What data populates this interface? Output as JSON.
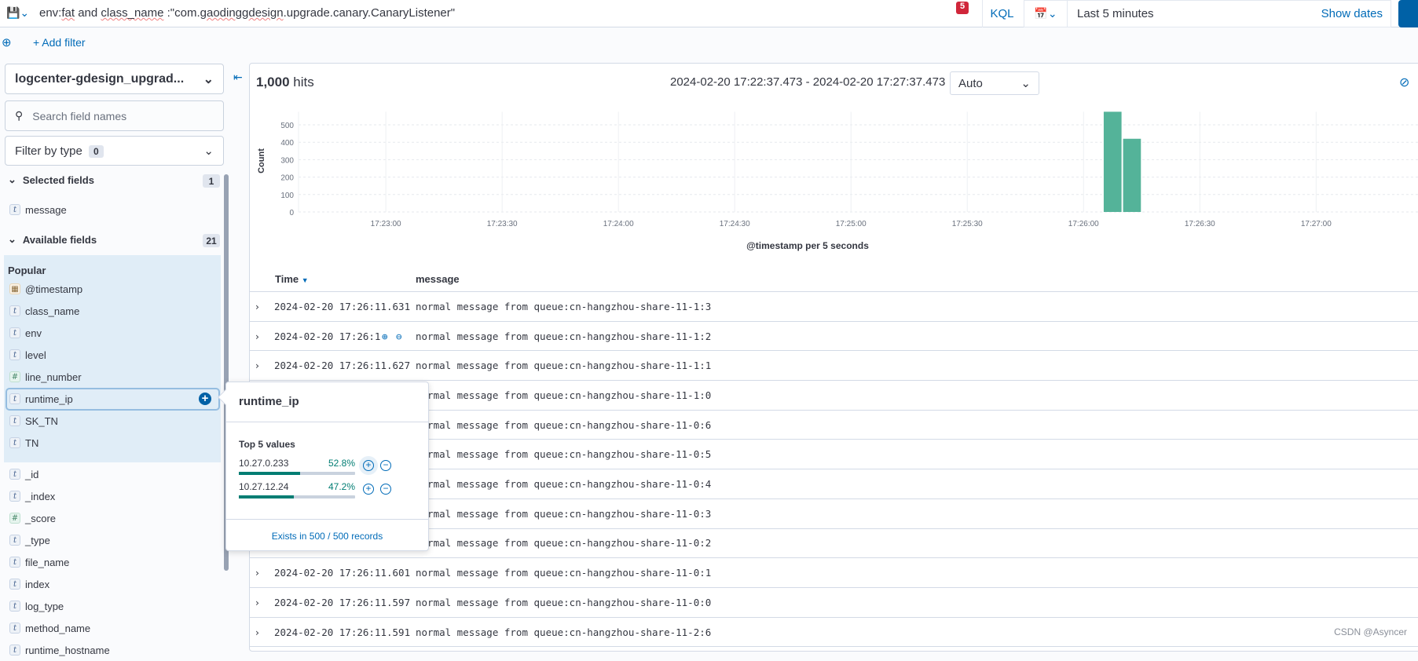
{
  "query": {
    "prefix": "env:",
    "fat": "fat",
    "and": " and ",
    "class_name": "class_name",
    "rest1": " :\"com.",
    "gaoding": "gaoding",
    ".": ".",
    "gdesign": "gdesign",
    "rest2": ".upgrade.canary.CanaryListener\"",
    "badge": "5",
    "language": "KQL"
  },
  "time": {
    "range": "Last 5 minutes",
    "show_dates": "Show dates"
  },
  "filters": {
    "add_filter": "+ Add filter"
  },
  "sidebar": {
    "index_pattern": "logcenter-gdesign_upgrad...",
    "search_placeholder": "Search field names",
    "filter_by_type": "Filter by type",
    "filter_count": "0",
    "selected_label": "Selected fields",
    "selected_count": "1",
    "selected": [
      {
        "name": "message",
        "type": "t"
      }
    ],
    "available_label": "Available fields",
    "available_count": "21",
    "popular_label": "Popular",
    "popular": [
      {
        "name": "@timestamp",
        "type": "date"
      },
      {
        "name": "class_name",
        "type": "t"
      },
      {
        "name": "env",
        "type": "t"
      },
      {
        "name": "level",
        "type": "t"
      },
      {
        "name": "line_number",
        "type": "#"
      },
      {
        "name": "runtime_ip",
        "type": "t"
      },
      {
        "name": "SK_TN",
        "type": "t"
      },
      {
        "name": "TN",
        "type": "t"
      }
    ],
    "others": [
      {
        "name": "_id",
        "type": "t"
      },
      {
        "name": "_index",
        "type": "t"
      },
      {
        "name": "_score",
        "type": "#"
      },
      {
        "name": "_type",
        "type": "t"
      },
      {
        "name": "file_name",
        "type": "t"
      },
      {
        "name": "index",
        "type": "t"
      },
      {
        "name": "log_type",
        "type": "t"
      },
      {
        "name": "method_name",
        "type": "t"
      },
      {
        "name": "runtime_hostname",
        "type": "t"
      }
    ]
  },
  "hits": {
    "count": "1,000",
    "label": " hits",
    "range": "2024-02-20 17:22:37.473 - 2024-02-20 17:27:37.473",
    "interval": "Auto"
  },
  "chart_data": {
    "type": "bar",
    "xlabel": "@timestamp per 5 seconds",
    "ylabel": "Count",
    "x_ticks": [
      "17:23:00",
      "17:23:30",
      "17:24:00",
      "17:24:30",
      "17:25:00",
      "17:25:30",
      "17:26:00",
      "17:26:30",
      "17:27:00"
    ],
    "y_ticks": [
      0,
      100,
      200,
      300,
      400,
      500
    ],
    "xlim": [
      "17:22:37.473",
      "17:27:37.473"
    ],
    "ylim": [
      0,
      575
    ],
    "grid": true,
    "color": "#54b399",
    "bars": [
      {
        "x": "17:26:05",
        "value": 580
      },
      {
        "x": "17:26:10",
        "value": 420
      }
    ]
  },
  "table": {
    "columns": [
      "Time",
      "message"
    ],
    "rows": [
      {
        "time": "2024-02-20 17:26:11.631",
        "message": "normal message from queue:cn-hangzhou-share-11-1:3"
      },
      {
        "time": "2024-02-20 17:26:11",
        "message": "normal message from queue:cn-hangzhou-share-11-1:2"
      },
      {
        "time": "2024-02-20 17:26:11.627",
        "message": "normal message from queue:cn-hangzhou-share-11-1:1"
      },
      {
        "time": "",
        "message": "normal message from queue:cn-hangzhou-share-11-1:0"
      },
      {
        "time": "",
        "message": "normal message from queue:cn-hangzhou-share-11-0:6"
      },
      {
        "time": "",
        "message": "normal message from queue:cn-hangzhou-share-11-0:5"
      },
      {
        "time": "",
        "message": "normal message from queue:cn-hangzhou-share-11-0:4"
      },
      {
        "time": "",
        "message": "normal message from queue:cn-hangzhou-share-11-0:3"
      },
      {
        "time": "",
        "message": "normal message from queue:cn-hangzhou-share-11-0:2"
      },
      {
        "time": "2024-02-20 17:26:11.601",
        "message": "normal message from queue:cn-hangzhou-share-11-0:1"
      },
      {
        "time": "2024-02-20 17:26:11.597",
        "message": "normal message from queue:cn-hangzhou-share-11-0:0"
      },
      {
        "time": "2024-02-20 17:26:11.591",
        "message": "normal message from queue:cn-hangzhou-share-11-2:6"
      }
    ]
  },
  "popover": {
    "title": "runtime_ip",
    "top_label": "Top 5 values",
    "values": [
      {
        "value": "10.27.0.233",
        "pct": "52.8%",
        "fraction": 0.528
      },
      {
        "value": "10.27.12.24",
        "pct": "47.2%",
        "fraction": 0.472
      }
    ],
    "footer": "Exists in 500 / 500 records"
  },
  "watermark": "CSDN @Asyncer"
}
